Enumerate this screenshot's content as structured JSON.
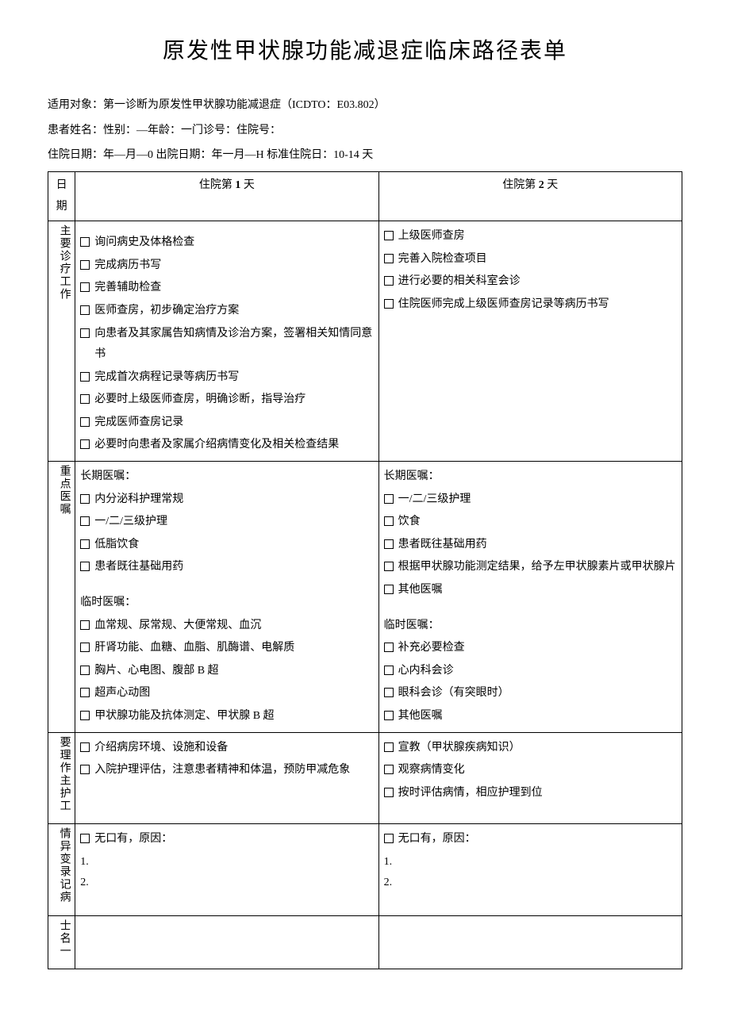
{
  "title": "原发性甲状腺功能减退症临床路径表单",
  "meta": {
    "line1": "适用对象：第一诊断为原发性甲状腺功能减退症（ICDTO：E03.802）",
    "line2": "患者姓名：性别：—年龄：一门诊号：住院号：",
    "line3": "住院日期：年—月—0 出院日期：年一月—H 标准住院日：10-14 天"
  },
  "headers": {
    "date": "日期",
    "day1_prefix": "住院第 ",
    "day1_num": "1",
    "day1_suffix": " 天",
    "day2_prefix": "住院第 ",
    "day2_num": "2",
    "day2_suffix": " 天"
  },
  "rows": {
    "r1_label": "主要诊疗工作",
    "r2_label": "重点医嘱",
    "r3_label": "要理作主护工",
    "r4_label": "情异变录记病",
    "r5_label": "士名一"
  },
  "day1": {
    "main_work": [
      "询问病史及体格检查",
      "完成病历书写",
      "完善辅助检查",
      "医师查房，初步确定治疗方案",
      "向患者及其家属告知病情及诊治方案，签署相关知情同意书",
      "完成首次病程记录等病历书写",
      "必要时上级医师查房，明确诊断，指导治疗",
      "完成医师查房记录",
      "必要时向患者及家属介绍病情变化及相关检查结果"
    ],
    "orders_long_title": "长期医嘱：",
    "orders_long": [
      "内分泌科护理常规",
      "一/二/三级护理",
      "低脂饮食",
      "患者既往基础用药"
    ],
    "orders_temp_title": "临时医嘱：",
    "orders_temp": [
      "血常规、尿常规、大便常规、血沉",
      "肝肾功能、血糖、血脂、肌酶谱、电解质",
      "胸片、心电图、腹部 B 超",
      "超声心动图",
      "甲状腺功能及抗体测定、甲状腺 B 超"
    ],
    "nursing": [
      "介绍病房环境、设施和设备",
      "入院护理评估，注意患者精神和体温，预防甲减危象"
    ],
    "variation_t": "无口有，原因：",
    "variation_1": "1.",
    "variation_2": "2."
  },
  "day2": {
    "main_work": [
      "上级医师查房",
      "完善入院检查项目",
      "进行必要的相关科室会诊",
      "住院医师完成上级医师查房记录等病历书写"
    ],
    "orders_long_title": "长期医嘱：",
    "orders_long": [
      "一/二/三级护理",
      "饮食",
      "患者既往基础用药",
      "根据甲状腺功能测定结果，给予左甲状腺素片或甲状腺片",
      "其他医嘱"
    ],
    "orders_temp_title": "临时医嘱：",
    "orders_temp": [
      "补充必要检查",
      "心内科会诊",
      "眼科会诊（有突眼时）",
      "其他医嘱"
    ],
    "nursing": [
      "宣教（甲状腺疾病知识）",
      "观察病情变化",
      "按时评估病情，相应护理到位"
    ],
    "variation_t": "无口有，原因：",
    "variation_1": "1.",
    "variation_2": "2."
  }
}
